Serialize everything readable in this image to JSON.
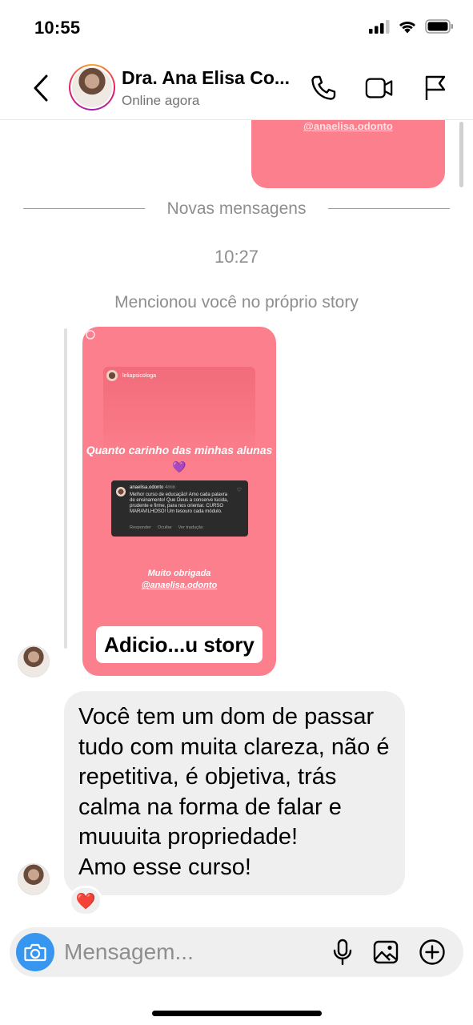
{
  "status_bar": {
    "time": "10:55"
  },
  "header": {
    "contact_name": "Dra. Ana Elisa Co...",
    "contact_status": "Online agora"
  },
  "thread": {
    "previous_story_handle": "@anaelisa.odonto",
    "divider_label": "Novas mensagens",
    "timestamp": "10:27",
    "mention_note": "Mencionou você no próprio story",
    "story": {
      "username": "leliapsicologa",
      "title": "Quanto carinho das minhas alunas",
      "title_emoji": "💜",
      "comment_user": "anaelisa.odonto",
      "comment_time": "4min",
      "comment_text": "Melhor curso de educação! Amo cada palavra de ensinamento! Que Deus a conserve lúcida, prudente e firme, para nos orientar. CURSO MARAVILHOSO! Um tesouro cada módulo.",
      "comment_actions": [
        "Responder",
        "Ocultar",
        "Ver tradução"
      ],
      "thanks": "Muito obrigada",
      "thanks_handle": "@anaelisa.odonto",
      "badge": "Adicio...u story"
    },
    "message": {
      "text": "Você tem um dom de passar tudo com muita clareza, não é repetitiva, é objetiva, trás calma na forma de falar e muuuita propriedade!\nAmo esse curso!",
      "reaction": "❤️"
    }
  },
  "composer": {
    "placeholder": "Mensagem..."
  },
  "colors": {
    "story_pink": "#fc7f8d",
    "camera_blue": "#3797f0",
    "bubble_gray": "#efefef"
  }
}
